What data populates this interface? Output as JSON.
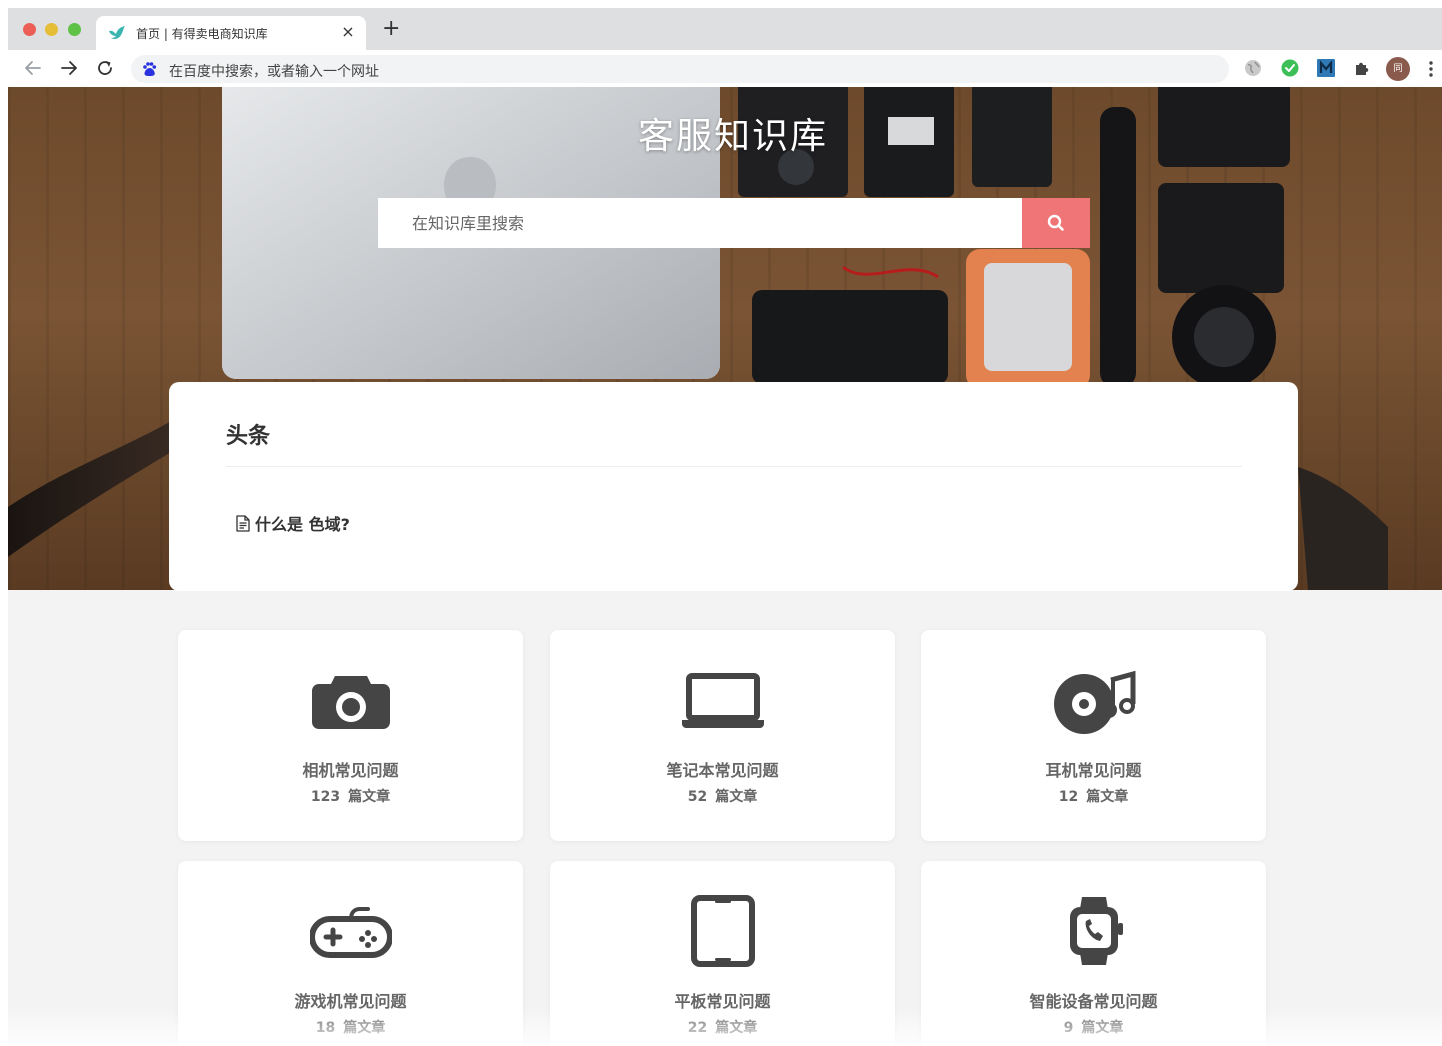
{
  "browser": {
    "tab_title": "首页 | 有得卖电商知识库",
    "tab_close": "×",
    "new_tab": "+",
    "omnibox_text": "在百度中搜索，或者输入一个网址",
    "avatar_text": "同"
  },
  "hero": {
    "title": "客服知识库",
    "search_placeholder": "在知识库里搜索"
  },
  "headlines": {
    "title": "头条",
    "articles": [
      {
        "title": "什么是 色域?"
      }
    ]
  },
  "categories": [
    {
      "name": "相机常见问题",
      "count": "123",
      "unit": "篇文章",
      "icon": "camera-icon"
    },
    {
      "name": "笔记本常见问题",
      "count": "52",
      "unit": "篇文章",
      "icon": "laptop-icon"
    },
    {
      "name": "耳机常见问题",
      "count": "12",
      "unit": "篇文章",
      "icon": "vinyl-music-icon"
    },
    {
      "name": "游戏机常见问题",
      "count": "18",
      "unit": "篇文章",
      "icon": "gamepad-icon"
    },
    {
      "name": "平板常见问题",
      "count": "22",
      "unit": "篇文章",
      "icon": "tablet-icon"
    },
    {
      "name": "智能设备常见问题",
      "count": "9",
      "unit": "篇文章",
      "icon": "smartwatch-icon"
    }
  ],
  "colors": {
    "accent": "#f07577",
    "icon": "#454545",
    "text": "#666666"
  }
}
